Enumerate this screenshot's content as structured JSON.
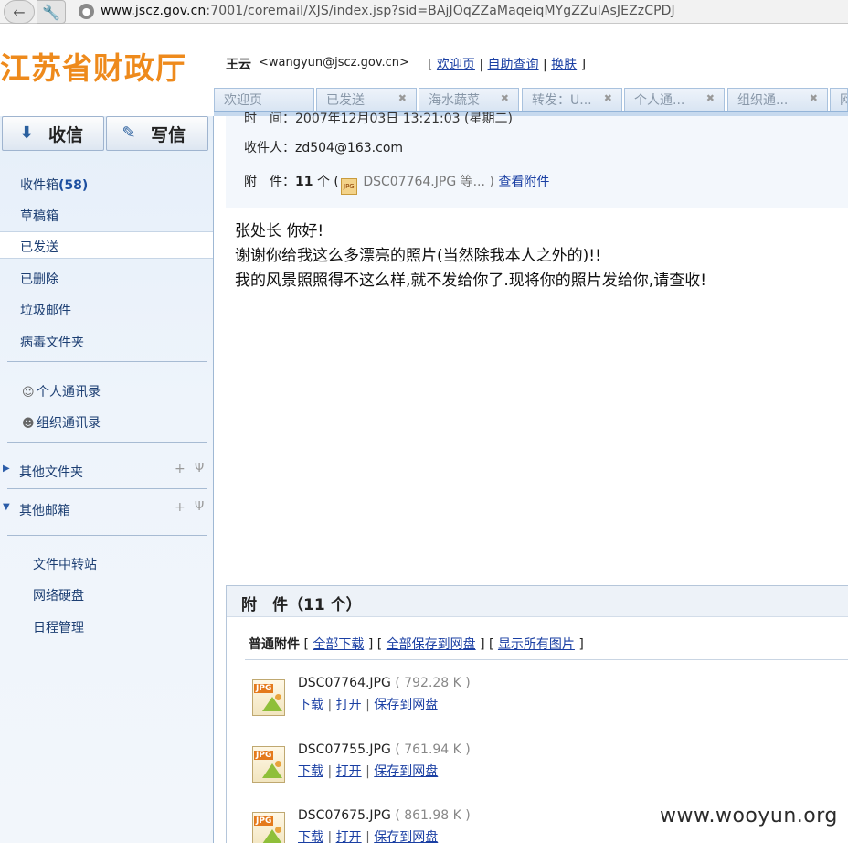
{
  "browser": {
    "url_host": "www.jscz.gov.cn",
    "url_rest": ":7001/coremail/XJS/index.jsp?sid=BAjJOqZZaMaqeiqMYgZZuIAsJEZzCPDJ"
  },
  "header": {
    "logo_text": "江苏省财政厅",
    "user_name": "王云",
    "user_email": "<wangyun@jscz.gov.cn>",
    "links": [
      "欢迎页",
      "自助查询",
      "换肤"
    ]
  },
  "tabs": [
    {
      "label": "欢迎页",
      "closable": false
    },
    {
      "label": "已发送",
      "closable": true
    },
    {
      "label": "海水蔬菜",
      "closable": true
    },
    {
      "label": "转发：U...",
      "closable": true
    },
    {
      "label": "个人通...",
      "closable": true
    },
    {
      "label": "组织通...",
      "closable": true
    },
    {
      "label": "网",
      "closable": false
    }
  ],
  "sidebar": {
    "inbox_button": "收信",
    "compose_button": "写信",
    "folders": [
      {
        "label": "收件箱",
        "count": "(58)"
      },
      {
        "label": "草稿箱"
      },
      {
        "label": "已发送",
        "active": true
      },
      {
        "label": "已删除"
      },
      {
        "label": "垃圾邮件"
      },
      {
        "label": "病毒文件夹"
      }
    ],
    "contacts": [
      "个人通讯录",
      "组织通讯录"
    ],
    "groups": [
      "其他文件夹",
      "其他邮箱"
    ],
    "tools": [
      "文件中转站",
      "网络硬盘",
      "日程管理"
    ]
  },
  "message": {
    "date_line": "时　间：2007年12月03日 13:21:03 (星期二)",
    "recipient_label": "收件人：",
    "recipient": "zd504@163.com",
    "attach_label": "附　件：",
    "attach_count": "11",
    "attach_unit": "个 (",
    "attach_preview": "DSC07764.JPG 等... )",
    "view_attachments": "查看附件",
    "body_lines": [
      "张处长 你好!",
      "谢谢你给我这么多漂亮的照片(当然除我本人之外的)!!",
      "我的风景照照得不这么样,就不发给你了.现将你的照片发给你,请查收!"
    ]
  },
  "attachments": {
    "header": "附　件（11 个）",
    "toolbar_label": "普通附件",
    "toolbar_links": [
      "全部下载",
      "全部保存到网盘",
      "显示所有图片"
    ],
    "items": [
      {
        "name": "DSC07764.JPG",
        "size": "( 792.28 K )"
      },
      {
        "name": "DSC07755.JPG",
        "size": "( 761.94 K )"
      },
      {
        "name": "DSC07675.JPG",
        "size": "( 861.98 K )"
      }
    ],
    "actions": [
      "下载",
      "打开",
      "保存到网盘"
    ]
  },
  "watermark": "www.wooyun.org"
}
